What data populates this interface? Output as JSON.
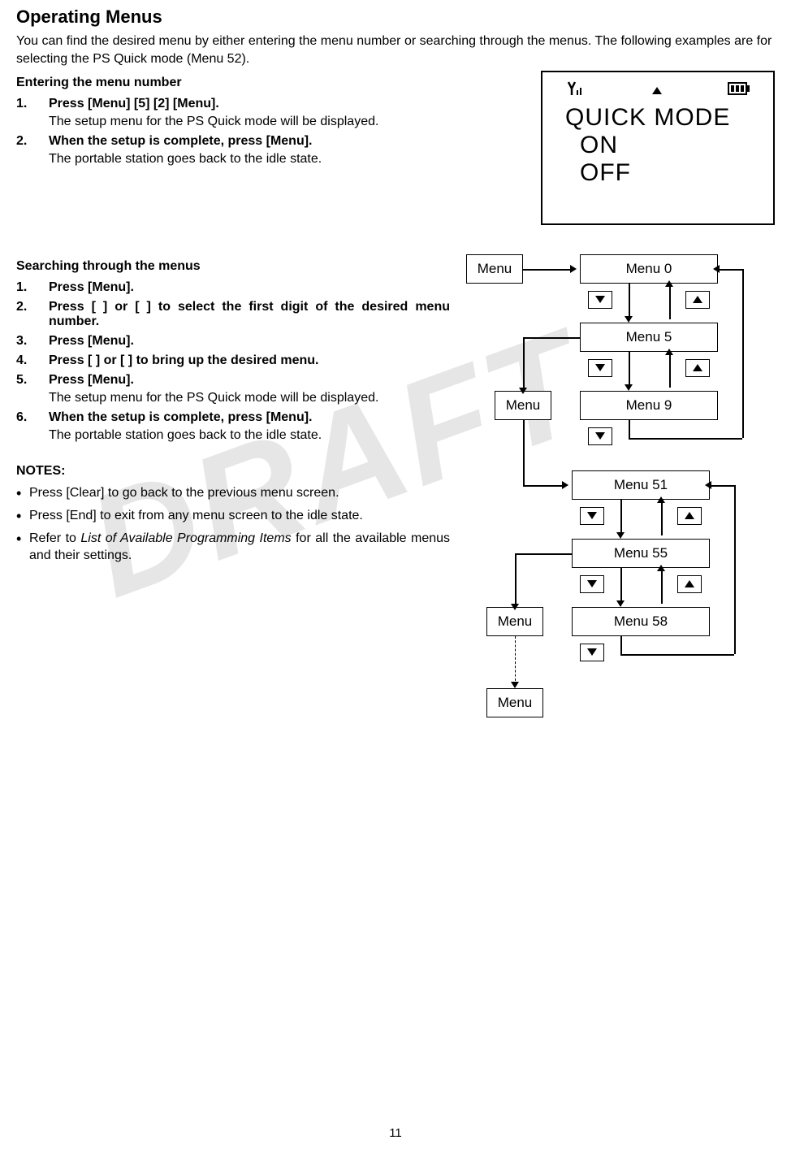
{
  "section_title": "Operating Menus",
  "intro": "You can find the desired menu by either entering the menu number or searching through the menus. The following examples are for selecting the PS Quick mode (Menu 52).",
  "heading_enter": "Entering the menu number",
  "steps_enter": [
    {
      "num": "1.",
      "head": "Press [Menu] [5] [2] [Menu].",
      "body": "The setup menu for the PS Quick mode will be displayed."
    },
    {
      "num": "2.",
      "head": "When the setup is complete, press [Menu].",
      "body": "The portable station goes back to the idle state."
    }
  ],
  "lcd": {
    "line1": "QUICK  MODE",
    "line2": "ON",
    "line3": "OFF"
  },
  "heading_search": "Searching through the menus",
  "steps_search": [
    {
      "num": "1.",
      "head": "Press [Menu].",
      "body": ""
    },
    {
      "num": "2.",
      "head": "Press [   ] or [   ] to select the first digit of the desired menu number.",
      "body": ""
    },
    {
      "num": "3.",
      "head": "Press [Menu].",
      "body": ""
    },
    {
      "num": "4.",
      "head": "Press [   ] or [   ] to bring up the desired menu.",
      "body": ""
    },
    {
      "num": "5.",
      "head": "Press [Menu].",
      "body": "The setup menu for the PS Quick mode will be displayed."
    },
    {
      "num": "6.",
      "head": "When the setup is complete, press [Menu].",
      "body": "The portable station goes back to the idle state."
    }
  ],
  "notes_heading": "NOTES:",
  "notes": [
    "Press [Clear] to go back to the previous menu screen.",
    "Press [End] to exit from any menu screen to the idle state.",
    "Refer to List of Available Programming Items for all the available menus and their settings."
  ],
  "notes_italic_phrase": "List of Available Programming Items",
  "flow": {
    "menu": "Menu",
    "items": [
      "Menu 0",
      "Menu 5",
      "Menu 9",
      "Menu 51",
      "Menu 55",
      "Menu 58"
    ]
  },
  "page_number": "11",
  "watermark": "DRAFT",
  "chart_data": {
    "type": "table",
    "title": "Menu navigation flow diagram",
    "description": "Press Menu to enter Menu 0. Use down/up arrows to cycle through Menu 0 → Menu 5 → Menu 9 (wraps back to Menu 0). From Menu 5, press Menu to enter second level: Menu 51 → Menu 55 → Menu 58 (wraps back to Menu 51). From Menu 58 press Menu, then Menu again (dashed) to finish.",
    "nodes": [
      {
        "id": "menu_root",
        "label": "Menu",
        "type": "button"
      },
      {
        "id": "m0",
        "label": "Menu 0",
        "type": "item"
      },
      {
        "id": "m5",
        "label": "Menu 5",
        "type": "item"
      },
      {
        "id": "m9",
        "label": "Menu 9",
        "type": "item"
      },
      {
        "id": "menu_mid",
        "label": "Menu",
        "type": "button"
      },
      {
        "id": "m51",
        "label": "Menu 51",
        "type": "item"
      },
      {
        "id": "m55",
        "label": "Menu 55",
        "type": "item"
      },
      {
        "id": "m58",
        "label": "Menu 58",
        "type": "item"
      },
      {
        "id": "menu_low",
        "label": "Menu",
        "type": "button"
      },
      {
        "id": "menu_end",
        "label": "Menu",
        "type": "button"
      }
    ],
    "edges": [
      {
        "from": "menu_root",
        "to": "m0",
        "via": "press"
      },
      {
        "from": "m0",
        "to": "m5",
        "via": "down"
      },
      {
        "from": "m5",
        "to": "m9",
        "via": "down"
      },
      {
        "from": "m9",
        "to": "m0",
        "via": "down-wrap"
      },
      {
        "from": "m5",
        "to": "m0",
        "via": "up"
      },
      {
        "from": "m9",
        "to": "m5",
        "via": "up"
      },
      {
        "from": "m5",
        "to": "menu_mid",
        "via": "press-left"
      },
      {
        "from": "menu_mid",
        "to": "m51",
        "via": "enter"
      },
      {
        "from": "m51",
        "to": "m55",
        "via": "down"
      },
      {
        "from": "m55",
        "to": "m58",
        "via": "down"
      },
      {
        "from": "m58",
        "to": "m51",
        "via": "down-wrap"
      },
      {
        "from": "m55",
        "to": "m51",
        "via": "up"
      },
      {
        "from": "m58",
        "to": "m55",
        "via": "up"
      },
      {
        "from": "m58",
        "to": "menu_low",
        "via": "press-left"
      },
      {
        "from": "menu_low",
        "to": "menu_end",
        "via": "press-dashed"
      }
    ]
  }
}
